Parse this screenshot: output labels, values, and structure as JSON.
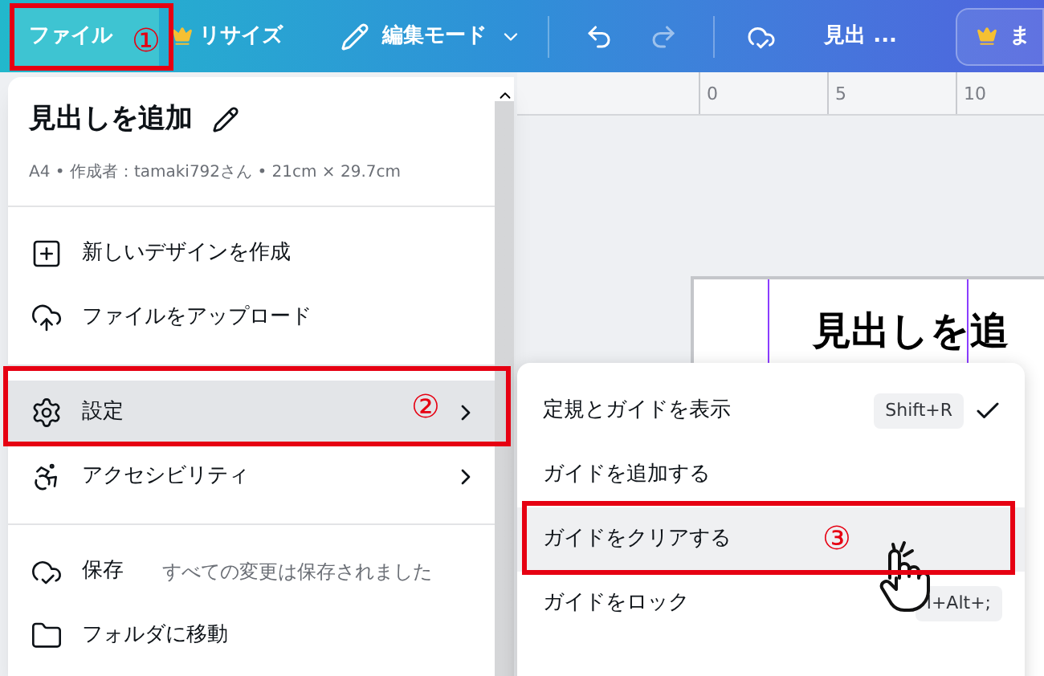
{
  "topbar": {
    "file": "ファイル",
    "resize": "リサイズ",
    "edit_mode": "編集モード",
    "title": "見出 ...",
    "premium": "ま"
  },
  "menu": {
    "title": "見出しを追加",
    "meta": "A4 • 作成者：tamaki792さん • 21cm × 29.7cm",
    "items": [
      {
        "kind": "divider"
      },
      {
        "kind": "item",
        "label": "新しいデザインを作成",
        "selected": false,
        "submenu": false
      },
      {
        "kind": "item",
        "label": "ファイルをアップロード",
        "selected": false,
        "submenu": false
      },
      {
        "kind": "divider"
      },
      {
        "kind": "item",
        "label": "設定",
        "selected": true,
        "submenu": true
      },
      {
        "kind": "item",
        "label": "アクセシビリティ",
        "selected": false,
        "submenu": true
      },
      {
        "kind": "divider"
      },
      {
        "kind": "item",
        "label": "保存",
        "note": "すべての変更は保存されました",
        "selected": false,
        "submenu": false
      },
      {
        "kind": "item",
        "label": "フォルダに移動",
        "selected": false,
        "submenu": false
      }
    ]
  },
  "submenu": {
    "items": [
      {
        "label": "定規とガイドを表示",
        "shortcut": "Shift+R",
        "checked": true,
        "selected": false
      },
      {
        "label": "ガイドを追加する",
        "checked": false,
        "selected": false
      },
      {
        "label": "ガイドをクリアする",
        "checked": false,
        "selected": true
      },
      {
        "label": "ガイドをロック",
        "shortcut": "l+Alt+;",
        "checked": false,
        "selected": false
      }
    ]
  },
  "ruler": {
    "ticks": [
      "0",
      "5",
      "10"
    ]
  },
  "canvas": {
    "heading": "見出しを追"
  },
  "annotations": [
    {
      "number": "①"
    },
    {
      "number": "②"
    },
    {
      "number": "③"
    }
  ]
}
